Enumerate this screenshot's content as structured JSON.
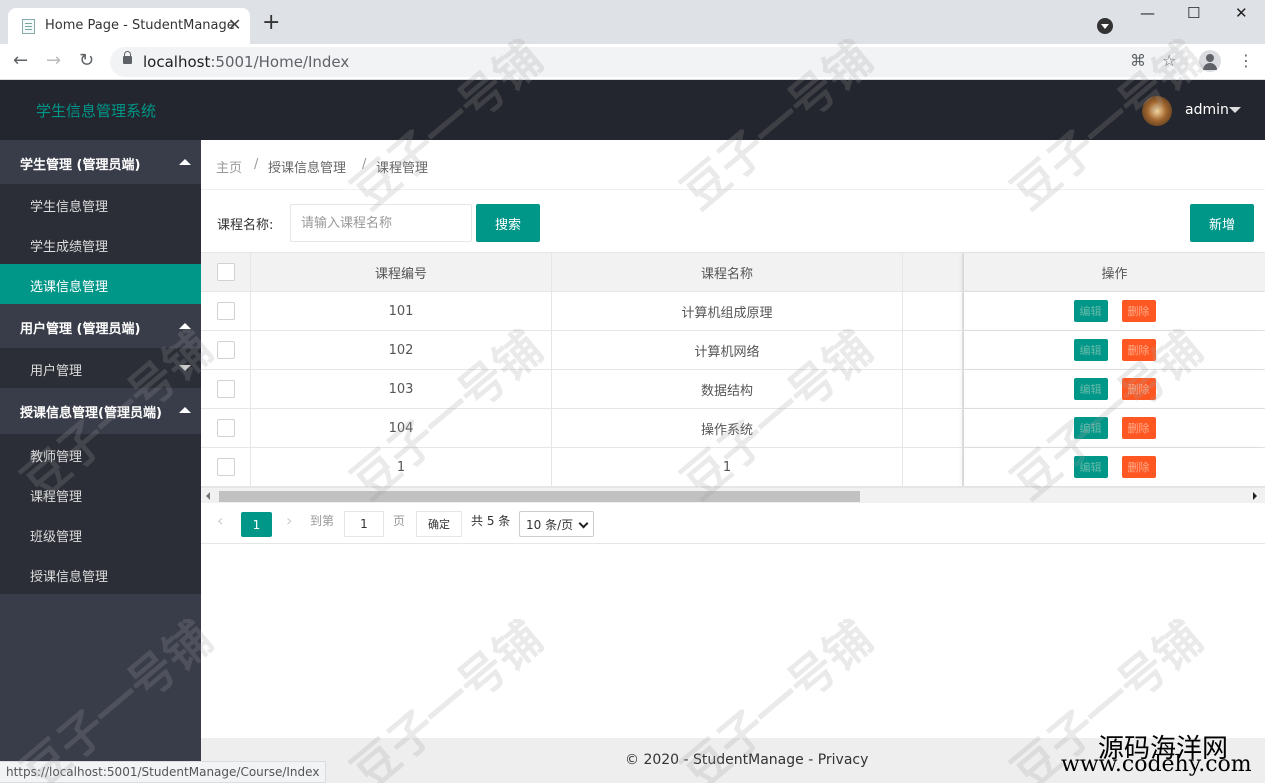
{
  "browser": {
    "tab_title": "Home Page - StudentManage",
    "tab_close": "✕",
    "new_tab": "+",
    "url_host": "localhost",
    "url_rest": ":5001/Home/Index",
    "win_min": "—",
    "win_max": "☐",
    "win_close": "✕",
    "back": "←",
    "forward": "→",
    "reload": "↻",
    "translate_icon": "⌘",
    "star_icon": "☆",
    "menu_icon": "⋮"
  },
  "app": {
    "logo": "学生信息管理系统",
    "user": "admin"
  },
  "sidebar": {
    "groups": [
      {
        "label": "学生管理 (管理员端)"
      },
      {
        "label": "用户管理 (管理员端)"
      },
      {
        "label": "授课信息管理(管理员端)"
      }
    ],
    "items": [
      {
        "label": "学生信息管理"
      },
      {
        "label": "学生成绩管理"
      },
      {
        "label": "选课信息管理"
      },
      {
        "label": "用户管理"
      },
      {
        "label": "教师管理"
      },
      {
        "label": "课程管理"
      },
      {
        "label": "班级管理"
      },
      {
        "label": "授课信息管理"
      }
    ]
  },
  "breadcrumb": [
    "主页",
    "授课信息管理",
    "课程管理"
  ],
  "breadcrumb_sep": "/",
  "search": {
    "label": "课程名称:",
    "placeholder": "请输入课程名称",
    "button": "搜索",
    "add_button": "新增"
  },
  "table": {
    "headers": {
      "id": "课程编号",
      "name": "课程名称",
      "op": "操作"
    },
    "edit_label": "编辑",
    "delete_label": "删除",
    "rows": [
      {
        "id": "101",
        "name": "计算机组成原理"
      },
      {
        "id": "102",
        "name": "计算机网络"
      },
      {
        "id": "103",
        "name": "数据结构"
      },
      {
        "id": "104",
        "name": "操作系统"
      },
      {
        "id": "1",
        "name": "1"
      }
    ]
  },
  "pager": {
    "prev": "‹",
    "current": "1",
    "next": "›",
    "goto_label": "到第",
    "goto_value": "1",
    "page_unit": "页",
    "confirm": "确定",
    "total": "共 5 条",
    "per_page": "10 条/页"
  },
  "footer": "© 2020 - StudentManage - Privacy",
  "status_bar_url": "https://localhost:5001/StudentManage/Course/Index",
  "watermark": "豆子一号铺",
  "corner_watermark": {
    "line1": "源码海洋网",
    "line2": "www.codehy.com"
  },
  "colors": {
    "accent": "#009688",
    "danger": "#ff5722",
    "header": "#23262e",
    "sidebar": "#393d49"
  }
}
